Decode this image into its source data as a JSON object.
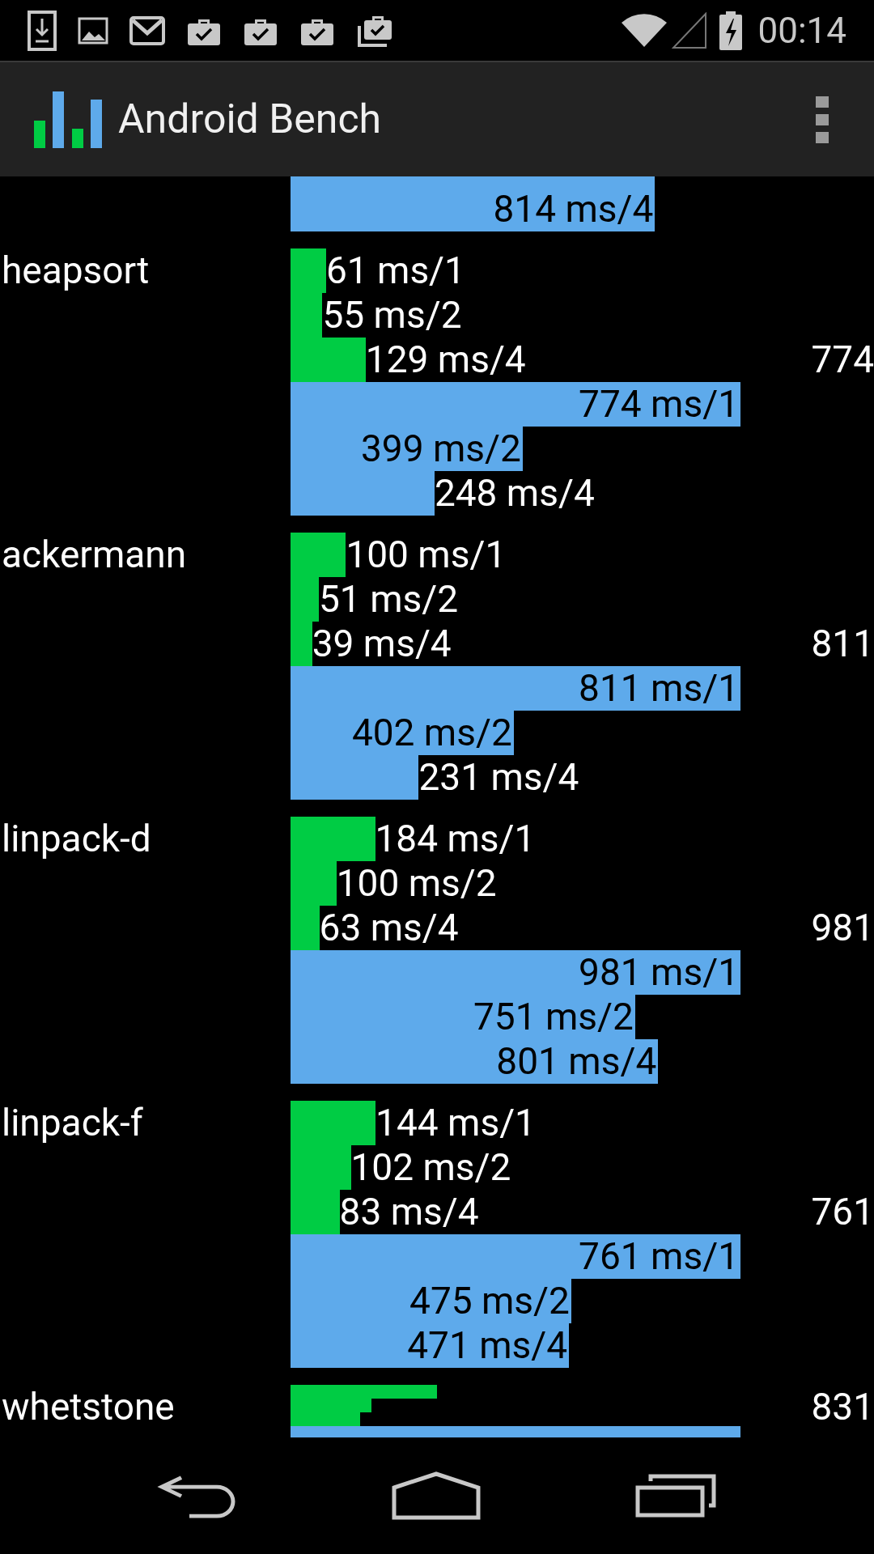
{
  "status_bar": {
    "time": "00:14"
  },
  "app_bar": {
    "title": "Android Bench"
  },
  "benchmarks": [
    {
      "rows": [
        {
          "color": "#5eaaeb",
          "level": 0.81
        },
        {
          "color": "#5eaaeb",
          "level": 0.81,
          "reading": "814 ms/4"
        }
      ]
    },
    {
      "name": "heapsort",
      "score": "774",
      "rows": [
        {
          "color": "#00cc44",
          "level": 0.079,
          "reading": "61 ms/1"
        },
        {
          "color": "#00cc44",
          "level": 0.071,
          "reading": "55 ms/2"
        },
        {
          "color": "#00cc44",
          "level": 0.167,
          "reading": "129 ms/4"
        },
        {
          "color": "#5eaaeb",
          "level": 1,
          "reading": "774 ms/1"
        },
        {
          "color": "#5eaaeb",
          "level": 0.516,
          "reading": "399 ms/2"
        },
        {
          "color": "#5eaaeb",
          "level": 0.32,
          "reading": "248 ms/4"
        }
      ]
    },
    {
      "name": "ackermann",
      "score": "811",
      "rows": [
        {
          "color": "#00cc44",
          "level": 0.123,
          "reading": "100 ms/1"
        },
        {
          "color": "#00cc44",
          "level": 0.063,
          "reading": "51 ms/2"
        },
        {
          "color": "#00cc44",
          "level": 0.048,
          "reading": "39 ms/4"
        },
        {
          "color": "#5eaaeb",
          "level": 1,
          "reading": "811 ms/1"
        },
        {
          "color": "#5eaaeb",
          "level": 0.496,
          "reading": "402 ms/2"
        },
        {
          "color": "#5eaaeb",
          "level": 0.285,
          "reading": "231 ms/4"
        }
      ]
    },
    {
      "name": "linpack-d",
      "score": "981",
      "rows": [
        {
          "color": "#00cc44",
          "level": 0.188,
          "reading": "184 ms/1"
        },
        {
          "color": "#00cc44",
          "level": 0.102,
          "reading": "100 ms/2"
        },
        {
          "color": "#00cc44",
          "level": 0.064,
          "reading": "63 ms/4"
        },
        {
          "color": "#5eaaeb",
          "level": 1,
          "reading": "981 ms/1"
        },
        {
          "color": "#5eaaeb",
          "level": 0.766,
          "reading": "751 ms/2"
        },
        {
          "color": "#5eaaeb",
          "level": 0.817,
          "reading": "801 ms/4"
        }
      ]
    },
    {
      "name": "linpack-f",
      "score": "761",
      "rows": [
        {
          "color": "#00cc44",
          "level": 0.189,
          "reading": "144 ms/1"
        },
        {
          "color": "#00cc44",
          "level": 0.134,
          "reading": "102 ms/2"
        },
        {
          "color": "#00cc44",
          "level": 0.109,
          "reading": "83 ms/4"
        },
        {
          "color": "#5eaaeb",
          "level": 1,
          "reading": "761 ms/1"
        },
        {
          "color": "#5eaaeb",
          "level": 0.624,
          "reading": "475 ms/2"
        },
        {
          "color": "#5eaaeb",
          "level": 0.619,
          "reading": "471 ms/4"
        }
      ]
    },
    {
      "name": "whetstone",
      "score": "831",
      "rows": [
        {
          "color": "#00cc44",
          "level": 0.325
        },
        {
          "color": "#00cc44",
          "level": 0.18
        },
        {
          "color": "#00cc44",
          "level": 0.155
        },
        {
          "color": "#5eaaeb",
          "level": 1
        }
      ]
    }
  ]
}
